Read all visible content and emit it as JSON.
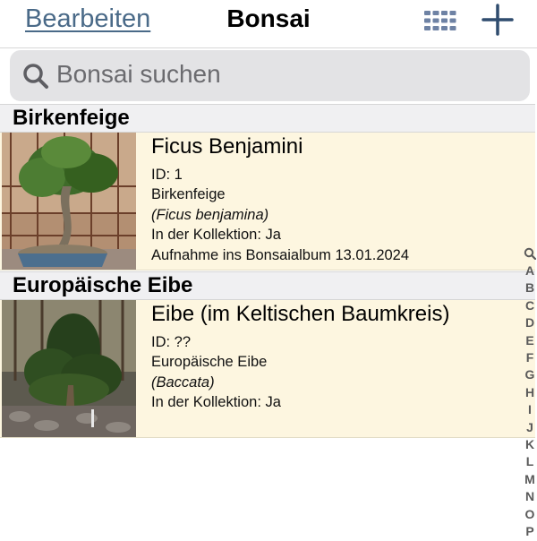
{
  "navbar": {
    "edit_label": "Bearbeiten",
    "title": "Bonsai",
    "grid_icon": "grid-icon",
    "add_icon": "plus-icon"
  },
  "search": {
    "placeholder": "Bonsai suchen",
    "icon": "search-icon"
  },
  "sections": [
    {
      "header": "Birkenfeige",
      "items": [
        {
          "title": "Ficus Benjamini",
          "id": "ID: 1",
          "common_name": "Birkenfeige",
          "latin_name": "(Ficus benjamina)",
          "collection": "In der Kollektion: Ja",
          "added": "Aufnahme ins Bonsaialbum 13.01.2024"
        }
      ]
    },
    {
      "header": "Europäische Eibe",
      "items": [
        {
          "title": "Eibe (im Keltischen Baumkreis)",
          "id": "ID: ??",
          "common_name": "Europäische Eibe",
          "latin_name": "(Baccata)",
          "collection": "In der Kollektion: Ja"
        }
      ]
    }
  ],
  "index_letters": [
    "A",
    "B",
    "C",
    "D",
    "E",
    "F",
    "G",
    "H",
    "I",
    "J",
    "K",
    "L",
    "M",
    "N",
    "O",
    "P"
  ],
  "colors": {
    "accent": "#4a6a88",
    "row_background": "#fdf6e0",
    "section_background": "#f0f0f2",
    "search_background": "#e3e3e5"
  }
}
